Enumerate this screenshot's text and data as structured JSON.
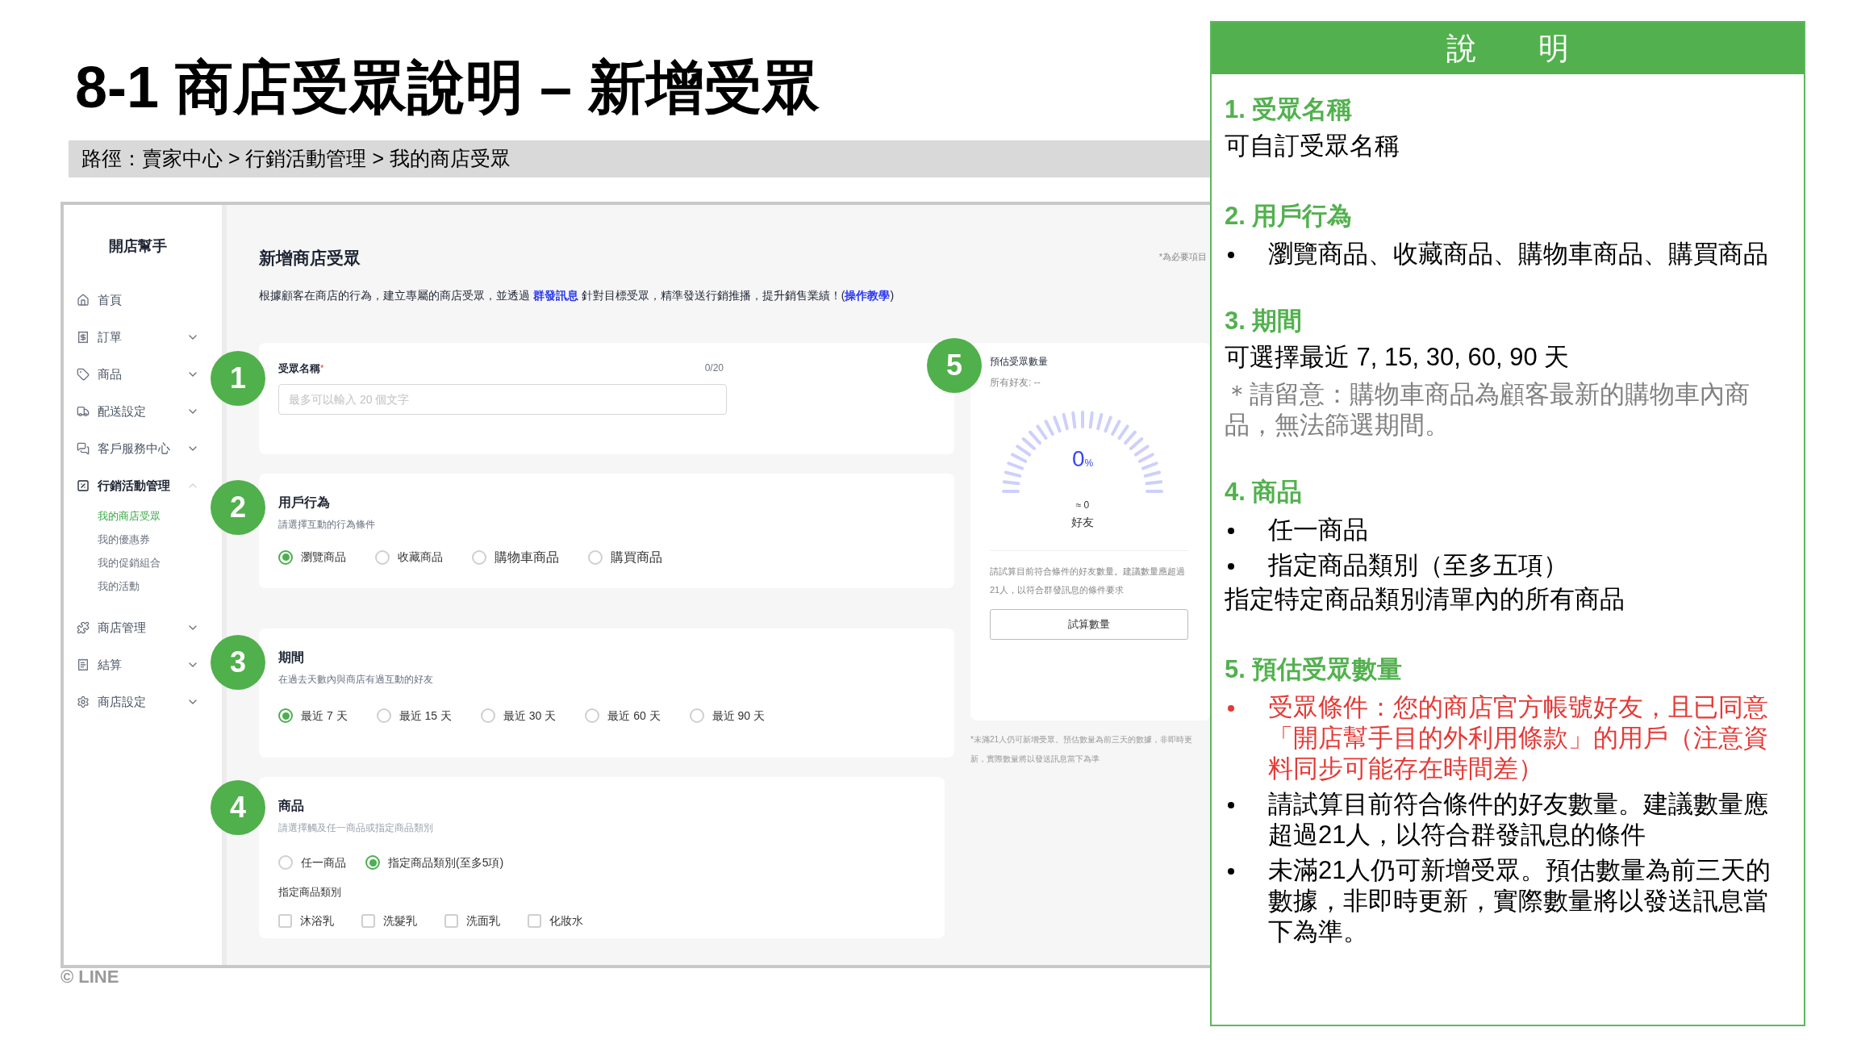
{
  "slide_title": "8-1 商店受眾說明 – 新增受眾",
  "path": "路徑：賣家中心 > 行銷活動管理 > 我的商店受眾",
  "sidebar": {
    "title": "開店幫手",
    "items": [
      {
        "kind": "home",
        "label": "首頁"
      },
      {
        "kind": "order",
        "label": "訂單",
        "expanded": false
      },
      {
        "kind": "product",
        "label": "商品",
        "expanded": false
      },
      {
        "kind": "shipping",
        "label": "配送設定",
        "expanded": false
      },
      {
        "kind": "service",
        "label": "客戶服務中心",
        "expanded": false
      },
      {
        "kind": "marketing",
        "label": "行銷活動管理",
        "expanded": true,
        "children": [
          {
            "label": "我的商店受眾",
            "selected": true
          },
          {
            "label": "我的優惠券",
            "selected": false
          },
          {
            "label": "我的促銷組合",
            "selected": false
          },
          {
            "label": "我的活動",
            "selected": false
          }
        ]
      },
      {
        "kind": "store",
        "label": "商店管理",
        "expanded": false
      },
      {
        "kind": "billing",
        "label": "結算",
        "expanded": false
      },
      {
        "kind": "settings",
        "label": "商店設定",
        "expanded": false
      }
    ]
  },
  "page": {
    "title": "新增商店受眾",
    "required_note": "*為必要項目",
    "description": [
      {
        "text": "根據顧客在商店的行為，建立專屬的商店受眾，並透過 ",
        "link": false
      },
      {
        "text": "群發訊息",
        "link": true
      },
      {
        "text": " 針對目標受眾，精準發送行銷推播，提升銷售業績！(",
        "link": false
      },
      {
        "text": "操作教學",
        "link": true
      },
      {
        "text": ")",
        "link": false
      }
    ]
  },
  "name_card": {
    "marker": "1",
    "label": "受眾名稱",
    "required_mark": "*",
    "counter": "0/20",
    "placeholder": "最多可以輸入 20 個文字"
  },
  "behavior_card": {
    "marker": "2",
    "title": "用戶行為",
    "hint": "請選擇互動的行為條件",
    "options": [
      {
        "label": "瀏覽商品",
        "selected": true
      },
      {
        "label": "收藏商品",
        "selected": false
      },
      {
        "label": "購物車商品",
        "selected": false
      },
      {
        "label": "購買商品",
        "selected": false
      }
    ]
  },
  "period_card": {
    "marker": "3",
    "title": "期間",
    "hint": "在過去天數內與商店有過互動的好友",
    "options": [
      {
        "label": "最近 7 天",
        "selected": true
      },
      {
        "label": "最近 15 天",
        "selected": false
      },
      {
        "label": "最近 30 天",
        "selected": false
      },
      {
        "label": "最近 60 天",
        "selected": false
      },
      {
        "label": "最近 90 天",
        "selected": false
      }
    ]
  },
  "product_card": {
    "marker": "4",
    "title": "商品",
    "hint": "請選擇觸及任一商品或指定商品類別",
    "options": [
      {
        "label": "任一商品",
        "selected": false
      },
      {
        "label": "指定商品類別(至多5項)",
        "selected": true
      }
    ],
    "category_label": "指定商品類別",
    "categories": [
      {
        "label": "沐浴乳",
        "checked": false
      },
      {
        "label": "洗髮乳",
        "checked": false
      },
      {
        "label": "洗面乳",
        "checked": false
      },
      {
        "label": "化妝水",
        "checked": false
      }
    ]
  },
  "estimate_card": {
    "marker": "5",
    "title": "預估受眾數量",
    "all_friends": "所有好友: --",
    "gauge": {
      "value": "0",
      "unit": "%"
    },
    "approx": "≈ 0",
    "unit_label": "好友",
    "advice": "請試算目前符合條件的好友數量。建議數量應超過21人，以符合群發訊息的條件要求",
    "button": "試算數量",
    "footnote": "*未滿21人仍可新增受眾。預估數量為前三天的數據，非即時更新，實際數量將以發送訊息當下為準"
  },
  "footer_logo": "© LINE",
  "explanation": {
    "title": "說　　明",
    "sections": [
      {
        "heading": "1. 受眾名稱",
        "lines": [
          {
            "kind": "text",
            "text": "可自訂受眾名稱"
          }
        ]
      },
      {
        "heading": "2. 用戶行為",
        "lines": [
          {
            "kind": "bullet",
            "text": "瀏覽商品、收藏商品、購物車商品、購買商品"
          }
        ]
      },
      {
        "heading": "3. 期間",
        "lines": [
          {
            "kind": "text",
            "text": "可選擇最近 7, 15, 30, 60, 90 天"
          },
          {
            "kind": "note",
            "text": "＊請留意：購物車商品為顧客最新的購物車內商品，無法篩選期間。"
          }
        ]
      },
      {
        "heading": "4. 商品",
        "lines": [
          {
            "kind": "bullet",
            "text": "任一商品"
          },
          {
            "kind": "bullet",
            "text": "指定商品類別（至多五項）"
          },
          {
            "kind": "text",
            "text": "指定特定商品類別清單內的所有商品"
          }
        ]
      },
      {
        "heading": "5. 預估受眾數量",
        "lines": [
          {
            "kind": "alert",
            "text": "受眾條件：您的商店官方帳號好友，且已同意「開店幫手目的外利用條款」的用戶（注意資料同步可能存在時間差）"
          },
          {
            "kind": "bullet",
            "text": "請試算目前符合條件的好友數量。建議數量應超過21人，以符合群發訊息的條件"
          },
          {
            "kind": "bullet",
            "text": "未滿21人仍可新增受眾。預估數量為前三天的數據，非即時更新，實際數量將以發送訊息當下為準。"
          }
        ]
      }
    ]
  }
}
